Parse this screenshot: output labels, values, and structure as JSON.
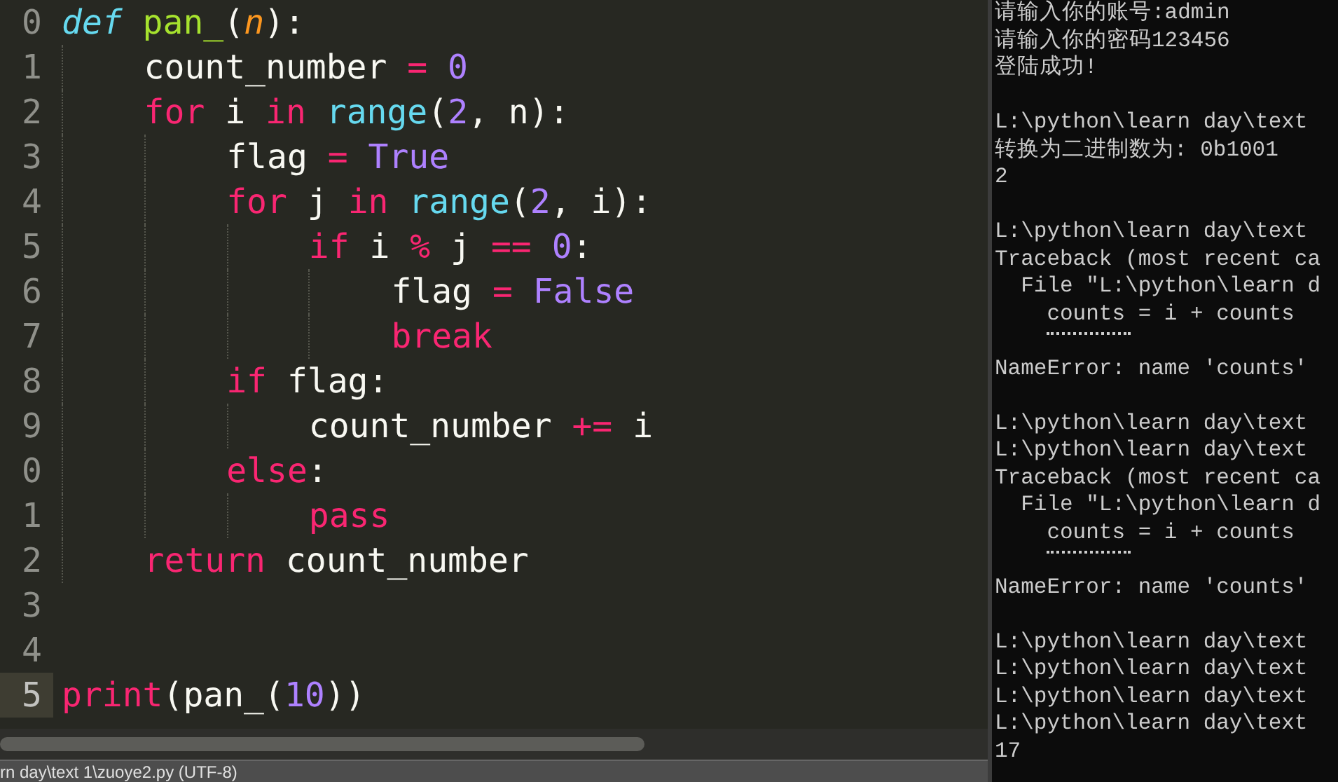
{
  "editor": {
    "lines": [
      {
        "number": "0",
        "current": false,
        "tokens": [
          {
            "kind": "defkw",
            "text": "def"
          },
          {
            "kind": "fname",
            "text": " pan_"
          },
          {
            "kind": "plain",
            "text": "("
          },
          {
            "kind": "param",
            "text": "n"
          },
          {
            "kind": "plain",
            "text": "):"
          }
        ]
      },
      {
        "number": "1",
        "current": false,
        "tokens": [
          {
            "kind": "plain",
            "text": "    count_number "
          },
          {
            "kind": "keyword",
            "text": "="
          },
          {
            "kind": "number",
            "text": " 0"
          }
        ]
      },
      {
        "number": "2",
        "current": false,
        "tokens": [
          {
            "kind": "keyword",
            "text": "    for"
          },
          {
            "kind": "plain",
            "text": " i "
          },
          {
            "kind": "keyword",
            "text": "in"
          },
          {
            "kind": "builtin",
            "text": " range"
          },
          {
            "kind": "plain",
            "text": "("
          },
          {
            "kind": "number",
            "text": "2"
          },
          {
            "kind": "plain",
            "text": ", n):"
          }
        ]
      },
      {
        "number": "3",
        "current": false,
        "tokens": [
          {
            "kind": "plain",
            "text": "        flag "
          },
          {
            "kind": "keyword",
            "text": "="
          },
          {
            "kind": "number",
            "text": " True"
          }
        ]
      },
      {
        "number": "4",
        "current": false,
        "tokens": [
          {
            "kind": "keyword",
            "text": "        for"
          },
          {
            "kind": "plain",
            "text": " j "
          },
          {
            "kind": "keyword",
            "text": "in"
          },
          {
            "kind": "builtin",
            "text": " range"
          },
          {
            "kind": "plain",
            "text": "("
          },
          {
            "kind": "number",
            "text": "2"
          },
          {
            "kind": "plain",
            "text": ", i):"
          }
        ]
      },
      {
        "number": "5",
        "current": false,
        "tokens": [
          {
            "kind": "keyword",
            "text": "            if"
          },
          {
            "kind": "plain",
            "text": " i "
          },
          {
            "kind": "keyword",
            "text": "%"
          },
          {
            "kind": "plain",
            "text": " j "
          },
          {
            "kind": "keyword",
            "text": "=="
          },
          {
            "kind": "number",
            "text": " 0"
          },
          {
            "kind": "plain",
            "text": ":"
          }
        ]
      },
      {
        "number": "6",
        "current": false,
        "tokens": [
          {
            "kind": "plain",
            "text": "                flag "
          },
          {
            "kind": "keyword",
            "text": "="
          },
          {
            "kind": "number",
            "text": " False"
          }
        ]
      },
      {
        "number": "7",
        "current": false,
        "tokens": [
          {
            "kind": "keyword",
            "text": "                break"
          }
        ]
      },
      {
        "number": "8",
        "current": false,
        "tokens": [
          {
            "kind": "keyword",
            "text": "        if"
          },
          {
            "kind": "plain",
            "text": " flag:"
          }
        ]
      },
      {
        "number": "9",
        "current": false,
        "tokens": [
          {
            "kind": "plain",
            "text": "            count_number "
          },
          {
            "kind": "keyword",
            "text": "+="
          },
          {
            "kind": "plain",
            "text": " i"
          }
        ]
      },
      {
        "number": "0",
        "current": false,
        "tokens": [
          {
            "kind": "keyword",
            "text": "        else"
          },
          {
            "kind": "plain",
            "text": ":"
          }
        ]
      },
      {
        "number": "1",
        "current": false,
        "tokens": [
          {
            "kind": "keyword",
            "text": "            pass"
          }
        ]
      },
      {
        "number": "2",
        "current": false,
        "tokens": [
          {
            "kind": "keyword",
            "text": "    return"
          },
          {
            "kind": "plain",
            "text": " count_number"
          }
        ]
      },
      {
        "number": "3",
        "current": false
      },
      {
        "number": "4",
        "current": false
      },
      {
        "number": "5",
        "current": true,
        "tokens": [
          {
            "kind": "keyword",
            "text": "print"
          },
          {
            "kind": "plain",
            "text": "(pan_("
          },
          {
            "kind": "number",
            "text": "10"
          },
          {
            "kind": "plain",
            "text": "))"
          }
        ]
      }
    ],
    "status": "rn day\\text 1\\zuoye2.py (UTF-8)"
  },
  "terminal": {
    "lines": [
      {
        "kind": "text",
        "text": "请输入你的账号:admin"
      },
      {
        "kind": "text",
        "text": "请输入你的密码123456"
      },
      {
        "kind": "text",
        "text": "登陆成功!"
      },
      {
        "kind": "blank"
      },
      {
        "kind": "text",
        "text": "L:\\python\\learn day\\text"
      },
      {
        "kind": "text",
        "text": "转换为二进制数为: 0b1001"
      },
      {
        "kind": "text",
        "text": "2"
      },
      {
        "kind": "blank"
      },
      {
        "kind": "text",
        "text": "L:\\python\\learn day\\text"
      },
      {
        "kind": "text",
        "text": "Traceback (most recent ca"
      },
      {
        "kind": "text",
        "text": "  File \"L:\\python\\learn d"
      },
      {
        "kind": "text",
        "text": "    counts = i + counts"
      },
      {
        "kind": "marks"
      },
      {
        "kind": "text",
        "text": "NameError: name 'counts'"
      },
      {
        "kind": "blank"
      },
      {
        "kind": "text",
        "text": "L:\\python\\learn day\\text"
      },
      {
        "kind": "text",
        "text": "L:\\python\\learn day\\text"
      },
      {
        "kind": "text",
        "text": "Traceback (most recent ca"
      },
      {
        "kind": "text",
        "text": "  File \"L:\\python\\learn d"
      },
      {
        "kind": "text",
        "text": "    counts = i + counts"
      },
      {
        "kind": "marks"
      },
      {
        "kind": "text",
        "text": "NameError: name 'counts'"
      },
      {
        "kind": "blank"
      },
      {
        "kind": "text",
        "text": "L:\\python\\learn day\\text"
      },
      {
        "kind": "text",
        "text": "L:\\python\\learn day\\text"
      },
      {
        "kind": "text",
        "text": "L:\\python\\learn day\\text"
      },
      {
        "kind": "text",
        "text": "L:\\python\\learn day\\text"
      },
      {
        "kind": "text",
        "text": "17"
      }
    ]
  }
}
